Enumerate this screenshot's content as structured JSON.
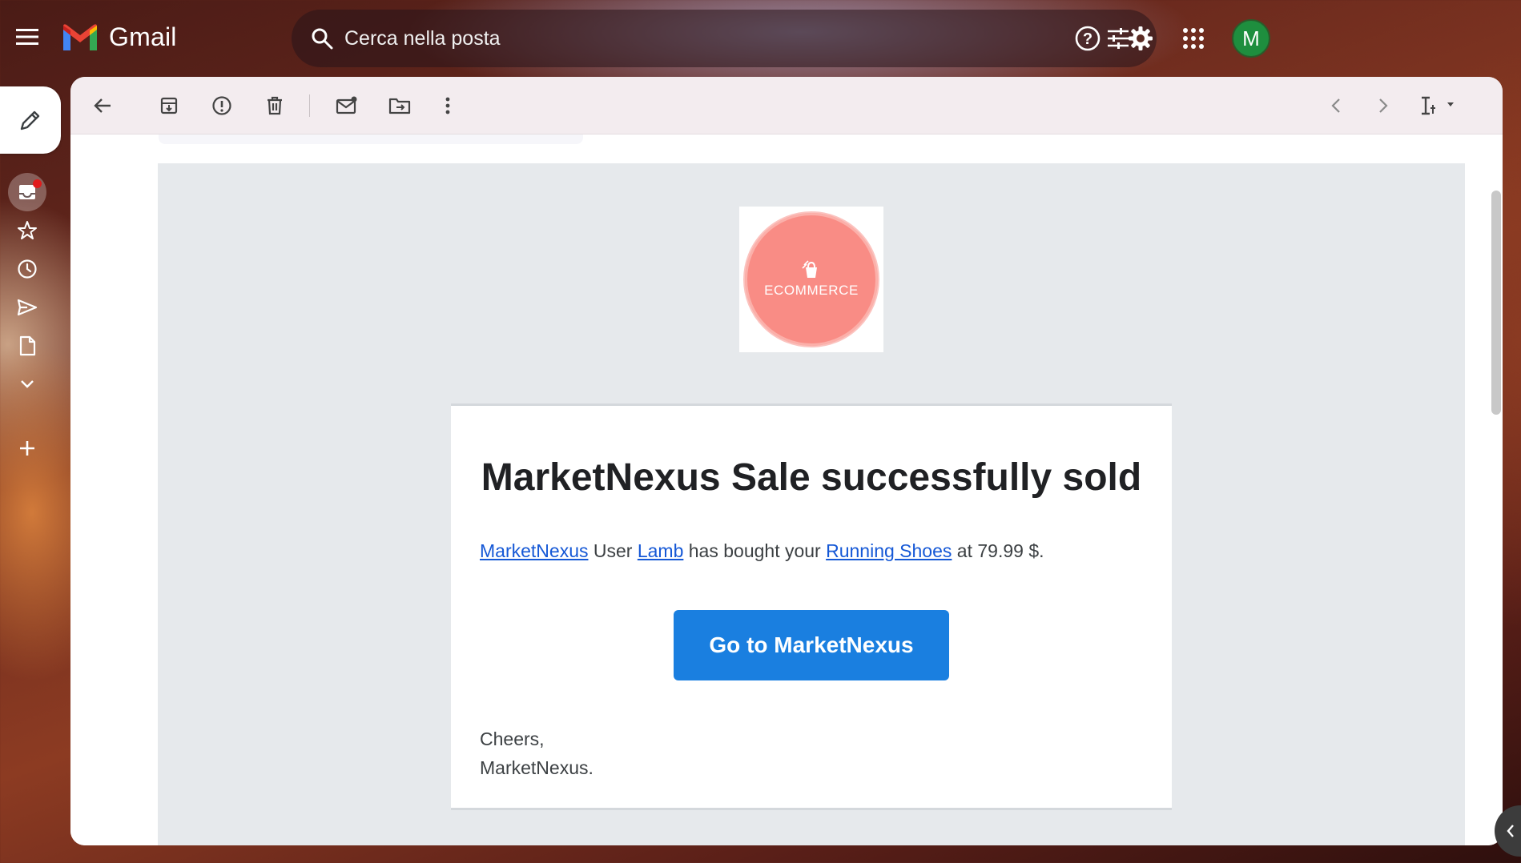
{
  "app": {
    "name": "Gmail"
  },
  "search": {
    "placeholder": "Cerca nella posta"
  },
  "account": {
    "initial": "M"
  },
  "colors": {
    "avatar": "#1e8e3e",
    "cta": "#1a7fe0",
    "link": "#1558d6",
    "logo_circle": "#f98c85",
    "notification_dot": "#e11b1b"
  },
  "topbar": {
    "icons": [
      "menu-icon",
      "help-icon",
      "settings-icon",
      "apps-icon"
    ]
  },
  "rail": {
    "items": [
      {
        "name": "inbox",
        "icon": "inbox-icon",
        "active": true,
        "notification": true
      },
      {
        "name": "starred",
        "icon": "star-icon"
      },
      {
        "name": "snoozed",
        "icon": "clock-icon"
      },
      {
        "name": "sent",
        "icon": "send-icon"
      },
      {
        "name": "drafts",
        "icon": "draft-icon"
      },
      {
        "name": "more",
        "icon": "chevron-down-icon"
      },
      {
        "name": "new-label",
        "icon": "plus-icon"
      }
    ]
  },
  "toolbar": {
    "icons": [
      "back-arrow-icon",
      "archive-icon",
      "report-spam-icon",
      "delete-icon",
      "mark-unread-icon",
      "move-to-icon",
      "more-vert-icon",
      "older-chevron-icon",
      "newer-chevron-icon",
      "input-tools-icon"
    ]
  },
  "email": {
    "logo_text": "ECOMMERCE",
    "title": "MarketNexus Sale successfully sold",
    "message": {
      "link1": "MarketNexus",
      "text1": " User ",
      "link2": "Lamb",
      "text2": " has bought your ",
      "link3": "Running Shoes",
      "text3": " at 79.99 $."
    },
    "cta_label": "Go to MarketNexus",
    "signoff": "Cheers,",
    "signature": "MarketNexus."
  }
}
